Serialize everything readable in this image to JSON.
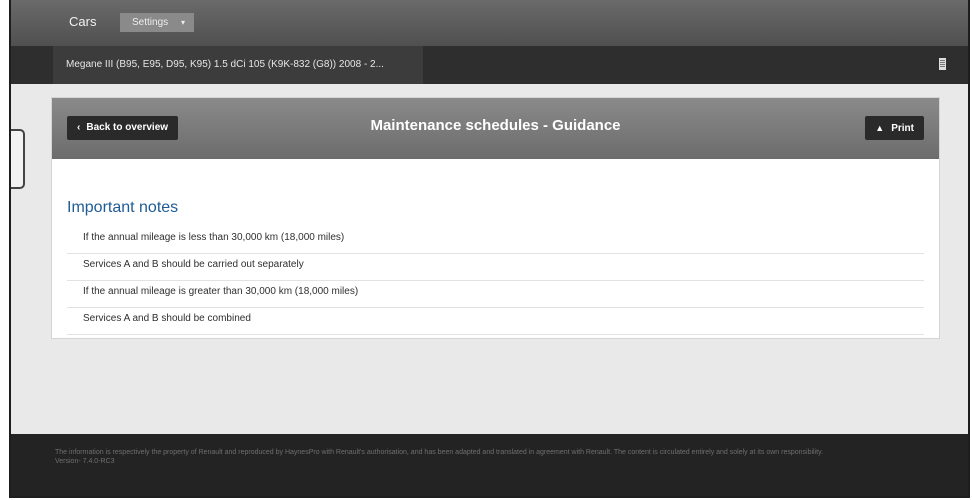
{
  "topbar": {
    "cars_label": "Cars",
    "settings_label": "Settings",
    "settings_caret": "▾"
  },
  "vehicle": {
    "name": "Megane III (B95, E95, D95, K95) 1.5 dCi 105 (K9K-832 (G8)) 2008 - 2..."
  },
  "card": {
    "back_label": "Back to overview",
    "back_chevron": "‹",
    "title": "Maintenance schedules - Guidance",
    "print_label": "Print",
    "print_icon": "printer-icon"
  },
  "notes": {
    "title": "Important notes",
    "items": [
      "If the annual mileage is less than 30,000 km (18,000 miles)",
      "Services A and B should be carried out separately",
      "If the annual mileage is greater than 30,000 km (18,000 miles)",
      "Services A and B should be combined"
    ]
  },
  "footer": {
    "disclaimer": "The information is respectively the property of Renault and reproduced by HaynesPro with Renault's authorisation, and has been adapted and translated in agreement with Renault. The content is circulated entirely and solely at its own responsibility.",
    "version": "Version- 7.4.0-RC3"
  },
  "colors": {
    "topbar": "#5e5e5e",
    "vehiclebar": "#2e2e2e",
    "card_header": "#7b7b7b",
    "notes_title": "#1f5c95",
    "footer": "#232323"
  }
}
